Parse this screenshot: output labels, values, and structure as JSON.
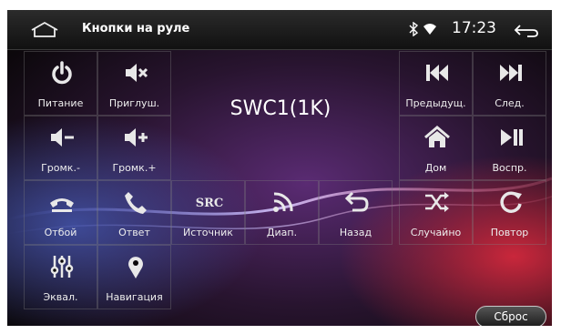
{
  "status_bar": {
    "title": "Кнопки на руле",
    "time": "17:23",
    "icons": [
      "home-icon",
      "bluetooth-icon",
      "wifi-icon",
      "back-icon"
    ]
  },
  "swc_value": "SWC1(1K)",
  "buttons": {
    "power": "Питание",
    "mute": "Приглуш.",
    "prev": "Предыдущ.",
    "next": "След.",
    "vol_down": "Громк.-",
    "vol_up": "Громк.+",
    "home": "Дом",
    "play": "Воспр.",
    "hangup": "Отбой",
    "answer": "Ответ",
    "source": "Источник",
    "band": "Диап.",
    "back": "Назад",
    "shuffle": "Случайно",
    "repeat": "Повтор",
    "eq": "Эквал.",
    "nav": "Навигация"
  },
  "src_glyph": "SRC",
  "reset_label": "Сброс",
  "colors": {
    "background": "#0a0709",
    "icon": "#e8e8e8",
    "text": "#ffffff"
  }
}
